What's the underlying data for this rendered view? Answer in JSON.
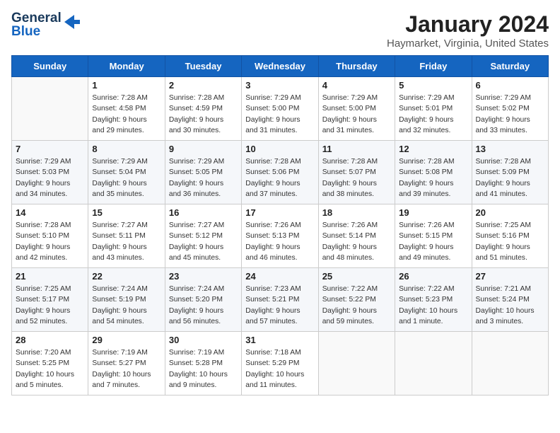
{
  "logo": {
    "line1": "General",
    "line2": "Blue"
  },
  "title": "January 2024",
  "subtitle": "Haymarket, Virginia, United States",
  "headers": [
    "Sunday",
    "Monday",
    "Tuesday",
    "Wednesday",
    "Thursday",
    "Friday",
    "Saturday"
  ],
  "weeks": [
    [
      {
        "num": "",
        "info": ""
      },
      {
        "num": "1",
        "info": "Sunrise: 7:28 AM\nSunset: 4:58 PM\nDaylight: 9 hours\nand 29 minutes."
      },
      {
        "num": "2",
        "info": "Sunrise: 7:28 AM\nSunset: 4:59 PM\nDaylight: 9 hours\nand 30 minutes."
      },
      {
        "num": "3",
        "info": "Sunrise: 7:29 AM\nSunset: 5:00 PM\nDaylight: 9 hours\nand 31 minutes."
      },
      {
        "num": "4",
        "info": "Sunrise: 7:29 AM\nSunset: 5:00 PM\nDaylight: 9 hours\nand 31 minutes."
      },
      {
        "num": "5",
        "info": "Sunrise: 7:29 AM\nSunset: 5:01 PM\nDaylight: 9 hours\nand 32 minutes."
      },
      {
        "num": "6",
        "info": "Sunrise: 7:29 AM\nSunset: 5:02 PM\nDaylight: 9 hours\nand 33 minutes."
      }
    ],
    [
      {
        "num": "7",
        "info": "Sunrise: 7:29 AM\nSunset: 5:03 PM\nDaylight: 9 hours\nand 34 minutes."
      },
      {
        "num": "8",
        "info": "Sunrise: 7:29 AM\nSunset: 5:04 PM\nDaylight: 9 hours\nand 35 minutes."
      },
      {
        "num": "9",
        "info": "Sunrise: 7:29 AM\nSunset: 5:05 PM\nDaylight: 9 hours\nand 36 minutes."
      },
      {
        "num": "10",
        "info": "Sunrise: 7:28 AM\nSunset: 5:06 PM\nDaylight: 9 hours\nand 37 minutes."
      },
      {
        "num": "11",
        "info": "Sunrise: 7:28 AM\nSunset: 5:07 PM\nDaylight: 9 hours\nand 38 minutes."
      },
      {
        "num": "12",
        "info": "Sunrise: 7:28 AM\nSunset: 5:08 PM\nDaylight: 9 hours\nand 39 minutes."
      },
      {
        "num": "13",
        "info": "Sunrise: 7:28 AM\nSunset: 5:09 PM\nDaylight: 9 hours\nand 41 minutes."
      }
    ],
    [
      {
        "num": "14",
        "info": "Sunrise: 7:28 AM\nSunset: 5:10 PM\nDaylight: 9 hours\nand 42 minutes."
      },
      {
        "num": "15",
        "info": "Sunrise: 7:27 AM\nSunset: 5:11 PM\nDaylight: 9 hours\nand 43 minutes."
      },
      {
        "num": "16",
        "info": "Sunrise: 7:27 AM\nSunset: 5:12 PM\nDaylight: 9 hours\nand 45 minutes."
      },
      {
        "num": "17",
        "info": "Sunrise: 7:26 AM\nSunset: 5:13 PM\nDaylight: 9 hours\nand 46 minutes."
      },
      {
        "num": "18",
        "info": "Sunrise: 7:26 AM\nSunset: 5:14 PM\nDaylight: 9 hours\nand 48 minutes."
      },
      {
        "num": "19",
        "info": "Sunrise: 7:26 AM\nSunset: 5:15 PM\nDaylight: 9 hours\nand 49 minutes."
      },
      {
        "num": "20",
        "info": "Sunrise: 7:25 AM\nSunset: 5:16 PM\nDaylight: 9 hours\nand 51 minutes."
      }
    ],
    [
      {
        "num": "21",
        "info": "Sunrise: 7:25 AM\nSunset: 5:17 PM\nDaylight: 9 hours\nand 52 minutes."
      },
      {
        "num": "22",
        "info": "Sunrise: 7:24 AM\nSunset: 5:19 PM\nDaylight: 9 hours\nand 54 minutes."
      },
      {
        "num": "23",
        "info": "Sunrise: 7:24 AM\nSunset: 5:20 PM\nDaylight: 9 hours\nand 56 minutes."
      },
      {
        "num": "24",
        "info": "Sunrise: 7:23 AM\nSunset: 5:21 PM\nDaylight: 9 hours\nand 57 minutes."
      },
      {
        "num": "25",
        "info": "Sunrise: 7:22 AM\nSunset: 5:22 PM\nDaylight: 9 hours\nand 59 minutes."
      },
      {
        "num": "26",
        "info": "Sunrise: 7:22 AM\nSunset: 5:23 PM\nDaylight: 10 hours\nand 1 minute."
      },
      {
        "num": "27",
        "info": "Sunrise: 7:21 AM\nSunset: 5:24 PM\nDaylight: 10 hours\nand 3 minutes."
      }
    ],
    [
      {
        "num": "28",
        "info": "Sunrise: 7:20 AM\nSunset: 5:25 PM\nDaylight: 10 hours\nand 5 minutes."
      },
      {
        "num": "29",
        "info": "Sunrise: 7:19 AM\nSunset: 5:27 PM\nDaylight: 10 hours\nand 7 minutes."
      },
      {
        "num": "30",
        "info": "Sunrise: 7:19 AM\nSunset: 5:28 PM\nDaylight: 10 hours\nand 9 minutes."
      },
      {
        "num": "31",
        "info": "Sunrise: 7:18 AM\nSunset: 5:29 PM\nDaylight: 10 hours\nand 11 minutes."
      },
      {
        "num": "",
        "info": ""
      },
      {
        "num": "",
        "info": ""
      },
      {
        "num": "",
        "info": ""
      }
    ]
  ]
}
